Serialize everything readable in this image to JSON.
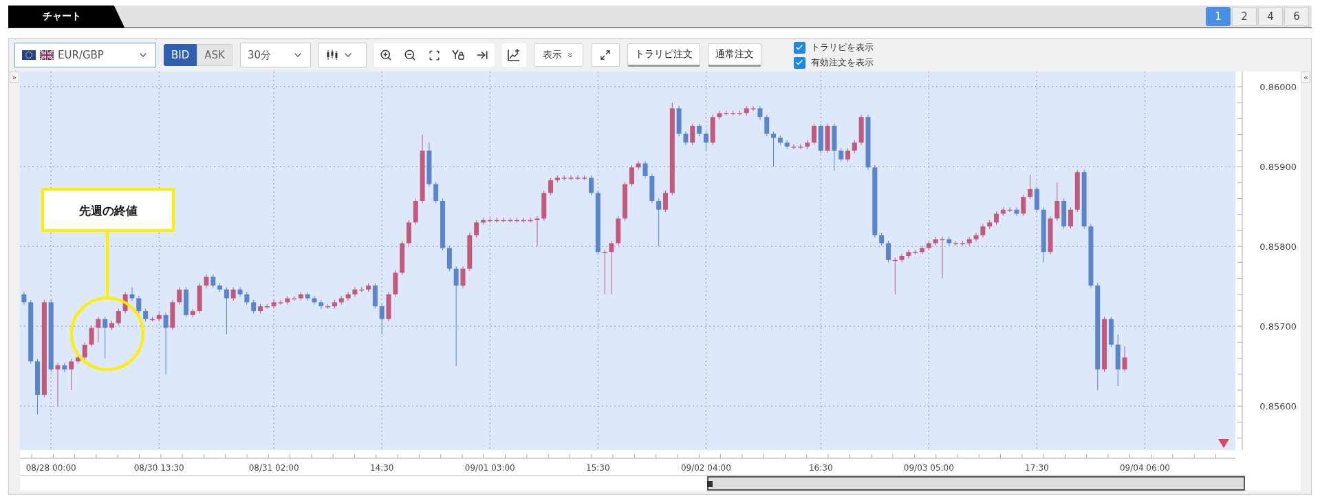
{
  "tab_bar": {
    "tabs": [
      {
        "label": "チャート",
        "selected": true
      }
    ],
    "layout_buttons": [
      {
        "label": "1",
        "selected": true
      },
      {
        "label": "2",
        "selected": false
      },
      {
        "label": "4",
        "selected": false
      },
      {
        "label": "6",
        "selected": false
      }
    ]
  },
  "toolbar": {
    "currency_pair": "EUR/GBP",
    "price_side": [
      {
        "label": "BID",
        "selected": true
      },
      {
        "label": "ASK",
        "selected": false
      }
    ],
    "interval": "30分",
    "display_menu": "表示",
    "order_buttons": [
      "トラリピ注文",
      "通常注文"
    ],
    "checkboxes": [
      {
        "label": "トラリピを表示",
        "checked": true
      },
      {
        "label": "有効注文を表示",
        "checked": true
      }
    ]
  },
  "chart": {
    "left_toggle": "»",
    "right_toggle": "«",
    "annotation": "先週の終値",
    "chart_data": {
      "type": "candlestick",
      "grid": true,
      "ylim": [
        0.85545,
        0.86019
      ],
      "yticks": [
        {
          "value": 0.86,
          "label": "0.86000"
        },
        {
          "value": 0.859,
          "label": "0.85900"
        },
        {
          "value": 0.858,
          "label": "0.85800"
        },
        {
          "value": 0.857,
          "label": "0.85700"
        },
        {
          "value": 0.856,
          "label": "0.85600"
        }
      ],
      "categories": [
        null,
        null,
        null,
        null,
        "08/28 00:00",
        null,
        null,
        null,
        null,
        null,
        null,
        null,
        null,
        null,
        null,
        null,
        null,
        null,
        null,
        null,
        "08/30 13:30",
        null,
        null,
        null,
        null,
        null,
        null,
        null,
        null,
        null,
        null,
        null,
        null,
        null,
        null,
        null,
        null,
        "08/31 02:00",
        null,
        null,
        null,
        null,
        null,
        null,
        null,
        null,
        null,
        null,
        null,
        null,
        null,
        null,
        null,
        "14:30",
        null,
        null,
        null,
        null,
        null,
        null,
        null,
        null,
        null,
        null,
        null,
        null,
        null,
        null,
        null,
        "09/01 03:00",
        null,
        null,
        null,
        null,
        null,
        null,
        null,
        null,
        null,
        null,
        null,
        null,
        null,
        null,
        null,
        "15:30",
        null,
        null,
        null,
        null,
        null,
        null,
        null,
        null,
        null,
        null,
        null,
        null,
        null,
        null,
        null,
        "09/02 04:00",
        null,
        null,
        null,
        null,
        null,
        null,
        null,
        null,
        null,
        null,
        null,
        null,
        null,
        null,
        null,
        null,
        "16:30",
        null,
        null,
        null,
        null,
        null,
        null,
        null,
        null,
        null,
        null,
        null,
        null,
        null,
        null,
        null,
        "09/03 05:00",
        null,
        null,
        null,
        null,
        null,
        null,
        null,
        null,
        null,
        null,
        null,
        null,
        null,
        null,
        null,
        "17:30",
        null,
        null,
        null,
        null,
        null,
        null,
        null,
        null,
        null,
        null,
        null,
        null,
        null,
        null,
        null,
        "09/04 06:00",
        null,
        null,
        null,
        null,
        null,
        null,
        null,
        null,
        null,
        null,
        null,
        null,
        null
      ],
      "ohlc": [
        [
          0.8574,
          0.85743,
          0.85727,
          0.8573
        ],
        [
          0.8573,
          0.85733,
          0.85653,
          0.85656
        ],
        [
          0.85656,
          0.85659,
          0.8559,
          0.85614
        ],
        [
          0.85614,
          0.85733,
          0.85611,
          0.8573
        ],
        [
          0.8573,
          0.85733,
          0.85643,
          0.85646
        ],
        [
          0.85646,
          0.85654,
          0.856,
          0.85651
        ],
        [
          0.85651,
          0.85654,
          0.85643,
          0.85646
        ],
        [
          0.85646,
          0.85659,
          0.8562,
          0.85656
        ],
        [
          0.85656,
          0.85664,
          0.85653,
          0.85661
        ],
        [
          0.85661,
          0.8568,
          0.85658,
          0.85677
        ],
        [
          0.85677,
          0.85701,
          0.85674,
          0.85698
        ],
        [
          0.85698,
          0.85712,
          0.8568,
          0.85709
        ],
        [
          0.85709,
          0.85712,
          0.8566,
          0.85698
        ],
        [
          0.85698,
          0.85707,
          0.85695,
          0.85704
        ],
        [
          0.85704,
          0.85722,
          0.85701,
          0.85719
        ],
        [
          0.85719,
          0.85743,
          0.85716,
          0.8574
        ],
        [
          0.8574,
          0.85749,
          0.85732,
          0.85735
        ],
        [
          0.85735,
          0.85738,
          0.85716,
          0.85719
        ],
        [
          0.85719,
          0.85722,
          0.85706,
          0.85709
        ],
        [
          0.85709,
          0.85712,
          0.85706,
          0.85709
        ],
        [
          0.85709,
          0.85717,
          0.85706,
          0.85714
        ],
        [
          0.85714,
          0.85717,
          0.8564,
          0.85698
        ],
        [
          0.85698,
          0.85733,
          0.85695,
          0.8573
        ],
        [
          0.8573,
          0.85749,
          0.85727,
          0.85746
        ],
        [
          0.85746,
          0.85749,
          0.85711,
          0.85714
        ],
        [
          0.85714,
          0.85722,
          0.85711,
          0.85719
        ],
        [
          0.85719,
          0.85754,
          0.85716,
          0.85751
        ],
        [
          0.85751,
          0.85765,
          0.85748,
          0.85762
        ],
        [
          0.85762,
          0.85765,
          0.85748,
          0.85751
        ],
        [
          0.85751,
          0.85754,
          0.85743,
          0.85746
        ],
        [
          0.85746,
          0.85749,
          0.8569,
          0.85735
        ],
        [
          0.85735,
          0.85749,
          0.85732,
          0.85746
        ],
        [
          0.85746,
          0.85749,
          0.85737,
          0.8574
        ],
        [
          0.8574,
          0.85743,
          0.85727,
          0.8573
        ],
        [
          0.8573,
          0.85733,
          0.85716,
          0.85719
        ],
        [
          0.85719,
          0.85728,
          0.85716,
          0.85725
        ],
        [
          0.85725,
          0.85728,
          0.85722,
          0.85725
        ],
        [
          0.85725,
          0.85733,
          0.85722,
          0.8573
        ],
        [
          0.8573,
          0.85733,
          0.85727,
          0.8573
        ],
        [
          0.8573,
          0.85738,
          0.85727,
          0.85735
        ],
        [
          0.85735,
          0.85738,
          0.85732,
          0.85735
        ],
        [
          0.85735,
          0.85743,
          0.85732,
          0.8574
        ],
        [
          0.8574,
          0.85743,
          0.85732,
          0.85735
        ],
        [
          0.85735,
          0.85738,
          0.85727,
          0.8573
        ],
        [
          0.8573,
          0.85733,
          0.85722,
          0.85725
        ],
        [
          0.85725,
          0.85728,
          0.85722,
          0.85725
        ],
        [
          0.85725,
          0.85733,
          0.85722,
          0.8573
        ],
        [
          0.8573,
          0.85738,
          0.85727,
          0.85735
        ],
        [
          0.85735,
          0.85743,
          0.85732,
          0.8574
        ],
        [
          0.8574,
          0.85749,
          0.85737,
          0.85746
        ],
        [
          0.85746,
          0.85749,
          0.85743,
          0.85746
        ],
        [
          0.85746,
          0.85754,
          0.85743,
          0.85751
        ],
        [
          0.85751,
          0.85754,
          0.85722,
          0.85725
        ],
        [
          0.85725,
          0.85728,
          0.8569,
          0.85709
        ],
        [
          0.85709,
          0.85743,
          0.85706,
          0.8574
        ],
        [
          0.8574,
          0.8577,
          0.85737,
          0.85767
        ],
        [
          0.85767,
          0.85807,
          0.85764,
          0.85804
        ],
        [
          0.85804,
          0.85833,
          0.85801,
          0.8583
        ],
        [
          0.8583,
          0.8586,
          0.85827,
          0.85857
        ],
        [
          0.85857,
          0.8594,
          0.85854,
          0.8592
        ],
        [
          0.8592,
          0.8593,
          0.85875,
          0.85878
        ],
        [
          0.85878,
          0.85881,
          0.85854,
          0.85857
        ],
        [
          0.85857,
          0.8586,
          0.85795,
          0.85798
        ],
        [
          0.85798,
          0.85801,
          0.85769,
          0.85772
        ],
        [
          0.85772,
          0.85775,
          0.8565,
          0.85751
        ],
        [
          0.85751,
          0.85775,
          0.85748,
          0.85772
        ],
        [
          0.85772,
          0.85817,
          0.85769,
          0.85814
        ],
        [
          0.85814,
          0.85833,
          0.85811,
          0.8583
        ],
        [
          0.8583,
          0.85836,
          0.85827,
          0.85833
        ],
        [
          0.85833,
          0.85836,
          0.8583,
          0.85833
        ],
        [
          0.85833,
          0.85836,
          0.8583,
          0.85833
        ],
        [
          0.85833,
          0.85836,
          0.8583,
          0.85833
        ],
        [
          0.85833,
          0.85836,
          0.8583,
          0.85833
        ],
        [
          0.85833,
          0.85836,
          0.8583,
          0.85833
        ],
        [
          0.85833,
          0.85836,
          0.8583,
          0.85833
        ],
        [
          0.85833,
          0.85836,
          0.8583,
          0.85833
        ],
        [
          0.85833,
          0.85838,
          0.858,
          0.85835
        ],
        [
          0.85835,
          0.8587,
          0.85832,
          0.85867
        ],
        [
          0.85867,
          0.85886,
          0.85864,
          0.85883
        ],
        [
          0.85883,
          0.85889,
          0.8588,
          0.85886
        ],
        [
          0.85886,
          0.85889,
          0.85883,
          0.85886
        ],
        [
          0.85886,
          0.85889,
          0.85883,
          0.85886
        ],
        [
          0.85886,
          0.85889,
          0.85883,
          0.85886
        ],
        [
          0.85886,
          0.85889,
          0.85883,
          0.85886
        ],
        [
          0.85886,
          0.85889,
          0.85864,
          0.85867
        ],
        [
          0.85867,
          0.8587,
          0.8579,
          0.85793
        ],
        [
          0.85793,
          0.85796,
          0.8574,
          0.85793
        ],
        [
          0.85793,
          0.85807,
          0.8574,
          0.85804
        ],
        [
          0.85804,
          0.85838,
          0.85801,
          0.85835
        ],
        [
          0.85835,
          0.85881,
          0.85832,
          0.85878
        ],
        [
          0.85878,
          0.85902,
          0.85875,
          0.85899
        ],
        [
          0.85899,
          0.85907,
          0.85896,
          0.85904
        ],
        [
          0.85904,
          0.85907,
          0.85885,
          0.85888
        ],
        [
          0.85888,
          0.85891,
          0.85854,
          0.85857
        ],
        [
          0.85857,
          0.8586,
          0.858,
          0.85846
        ],
        [
          0.85846,
          0.8587,
          0.85843,
          0.85867
        ],
        [
          0.85867,
          0.8598,
          0.85864,
          0.85973
        ],
        [
          0.85973,
          0.85976,
          0.85938,
          0.85941
        ],
        [
          0.85941,
          0.85944,
          0.85927,
          0.8593
        ],
        [
          0.8593,
          0.85954,
          0.85927,
          0.85951
        ],
        [
          0.85951,
          0.85954,
          0.85938,
          0.85941
        ],
        [
          0.85941,
          0.85944,
          0.8592,
          0.8593
        ],
        [
          0.8593,
          0.85965,
          0.85927,
          0.85962
        ],
        [
          0.85962,
          0.8597,
          0.85959,
          0.85967
        ],
        [
          0.85967,
          0.8597,
          0.85964,
          0.85967
        ],
        [
          0.85967,
          0.8597,
          0.85964,
          0.85967
        ],
        [
          0.85967,
          0.8597,
          0.85964,
          0.85967
        ],
        [
          0.85967,
          0.85976,
          0.85964,
          0.85973
        ],
        [
          0.85973,
          0.85976,
          0.8597,
          0.85973
        ],
        [
          0.85973,
          0.85976,
          0.85959,
          0.85962
        ],
        [
          0.85962,
          0.85965,
          0.85938,
          0.85941
        ],
        [
          0.85941,
          0.85944,
          0.859,
          0.85936
        ],
        [
          0.85936,
          0.85939,
          0.85927,
          0.8593
        ],
        [
          0.8593,
          0.85933,
          0.85922,
          0.85925
        ],
        [
          0.85925,
          0.85928,
          0.85922,
          0.85925
        ],
        [
          0.85925,
          0.85928,
          0.85922,
          0.85925
        ],
        [
          0.85925,
          0.85933,
          0.85922,
          0.8593
        ],
        [
          0.8593,
          0.85954,
          0.85927,
          0.85951
        ],
        [
          0.85951,
          0.85954,
          0.85917,
          0.8592
        ],
        [
          0.8592,
          0.85954,
          0.85917,
          0.85951
        ],
        [
          0.85951,
          0.85954,
          0.85895,
          0.8592
        ],
        [
          0.8592,
          0.85923,
          0.85906,
          0.85909
        ],
        [
          0.85909,
          0.85923,
          0.85906,
          0.8592
        ],
        [
          0.8592,
          0.85933,
          0.85917,
          0.8593
        ],
        [
          0.8593,
          0.85965,
          0.85927,
          0.85962
        ],
        [
          0.85962,
          0.85965,
          0.85896,
          0.85899
        ],
        [
          0.85899,
          0.85902,
          0.85811,
          0.85814
        ],
        [
          0.85814,
          0.85817,
          0.85801,
          0.85804
        ],
        [
          0.85804,
          0.85807,
          0.8578,
          0.85783
        ],
        [
          0.85783,
          0.85786,
          0.8574,
          0.85783
        ],
        [
          0.85783,
          0.85791,
          0.8578,
          0.85788
        ],
        [
          0.85788,
          0.85796,
          0.85785,
          0.85793
        ],
        [
          0.85793,
          0.85796,
          0.8579,
          0.85793
        ],
        [
          0.85793,
          0.85801,
          0.8579,
          0.85798
        ],
        [
          0.85798,
          0.85807,
          0.85795,
          0.85804
        ],
        [
          0.85804,
          0.85812,
          0.85801,
          0.85809
        ],
        [
          0.85809,
          0.85812,
          0.8576,
          0.85809
        ],
        [
          0.85809,
          0.85812,
          0.85801,
          0.85804
        ],
        [
          0.85804,
          0.85807,
          0.85801,
          0.85804
        ],
        [
          0.85804,
          0.85807,
          0.85801,
          0.85804
        ],
        [
          0.85804,
          0.85812,
          0.85801,
          0.85809
        ],
        [
          0.85809,
          0.85817,
          0.85806,
          0.85814
        ],
        [
          0.85814,
          0.85828,
          0.85811,
          0.85825
        ],
        [
          0.85825,
          0.85833,
          0.85822,
          0.8583
        ],
        [
          0.8583,
          0.85844,
          0.85827,
          0.85841
        ],
        [
          0.85841,
          0.85849,
          0.85838,
          0.85846
        ],
        [
          0.85846,
          0.85849,
          0.85843,
          0.85846
        ],
        [
          0.85846,
          0.85849,
          0.85838,
          0.85841
        ],
        [
          0.85841,
          0.85865,
          0.85838,
          0.85862
        ],
        [
          0.85862,
          0.8589,
          0.85859,
          0.85872
        ],
        [
          0.85872,
          0.85875,
          0.85843,
          0.85846
        ],
        [
          0.85846,
          0.85849,
          0.8578,
          0.85793
        ],
        [
          0.85793,
          0.85838,
          0.8579,
          0.85835
        ],
        [
          0.85835,
          0.8588,
          0.85832,
          0.85857
        ],
        [
          0.85857,
          0.8586,
          0.85822,
          0.85825
        ],
        [
          0.85825,
          0.85849,
          0.85822,
          0.85846
        ],
        [
          0.85846,
          0.85896,
          0.85843,
          0.85893
        ],
        [
          0.85893,
          0.85896,
          0.85822,
          0.85825
        ],
        [
          0.85825,
          0.85828,
          0.85748,
          0.85751
        ],
        [
          0.85751,
          0.85754,
          0.8562,
          0.85646
        ],
        [
          0.85646,
          0.85712,
          0.85643,
          0.85709
        ],
        [
          0.85709,
          0.85712,
          0.85674,
          0.85677
        ],
        [
          0.85677,
          0.8569,
          0.85625,
          0.85646
        ],
        [
          0.85646,
          0.85675,
          0.85643,
          0.85661
        ],
        null,
        null,
        null,
        null,
        null,
        null,
        null,
        null,
        null,
        null,
        null,
        null,
        null,
        null,
        null,
        null
      ]
    }
  }
}
